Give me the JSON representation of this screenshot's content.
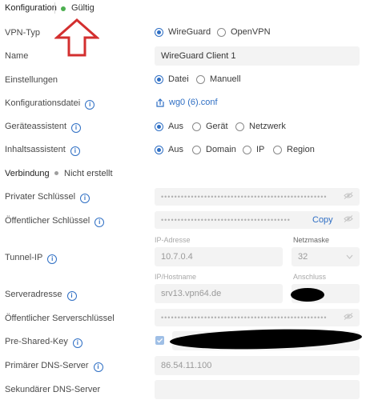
{
  "header": {
    "title": "Konfiguration",
    "status_text": "Gültig",
    "status_color": "#4caf50"
  },
  "vpn_type": {
    "label": "VPN-Typ",
    "options": [
      "WireGuard",
      "OpenVPN"
    ],
    "selected": "WireGuard"
  },
  "name": {
    "label": "Name",
    "value": "WireGuard Client 1"
  },
  "settings": {
    "label": "Einstellungen",
    "options": [
      "Datei",
      "Manuell"
    ],
    "selected": "Datei"
  },
  "config_file": {
    "label": "Konfigurationsdatei",
    "file": "wg0 (6).conf"
  },
  "device_assist": {
    "label": "Geräteassistent",
    "options": [
      "Aus",
      "Gerät",
      "Netzwerk"
    ],
    "selected": "Aus"
  },
  "content_assist": {
    "label": "Inhaltsassistent",
    "options": [
      "Aus",
      "Domain",
      "IP",
      "Region"
    ],
    "selected": "Aus"
  },
  "connection": {
    "title": "Verbindung",
    "status": "Nicht erstellt",
    "status_color": "#9e9e9e"
  },
  "private_key": {
    "label": "Privater Schlüssel",
    "value": "••••••••••••••••••••••••••••••••••••••••••••••••••"
  },
  "public_key": {
    "label": "Öffentlicher Schlüssel",
    "value": "•••••••••••••••••••••••••••••••••••••••",
    "copy_label": "Copy"
  },
  "tunnel_ip": {
    "label": "Tunnel-IP",
    "ip_caption": "IP-Adresse",
    "ip_value": "10.7.0.4",
    "mask_caption": "Netzmaske",
    "mask_value": "32"
  },
  "server": {
    "label": "Serveradresse",
    "host_caption": "IP/Hostname",
    "host_value": "srv13.vpn64.de",
    "port_caption": "Anschluss"
  },
  "server_key": {
    "label": "Öffentlicher Serverschlüssel",
    "value": "••••••••••••••••••••••••••••••••••••••••••••••••••"
  },
  "psk": {
    "label": "Pre-Shared-Key"
  },
  "dns1": {
    "label": "Primärer DNS-Server",
    "value": "86.54.11.100"
  },
  "dns2": {
    "label": "Sekundärer DNS-Server",
    "value": ""
  },
  "accent_color": "#2f6fc4",
  "arrow_color": "#d32f2f"
}
